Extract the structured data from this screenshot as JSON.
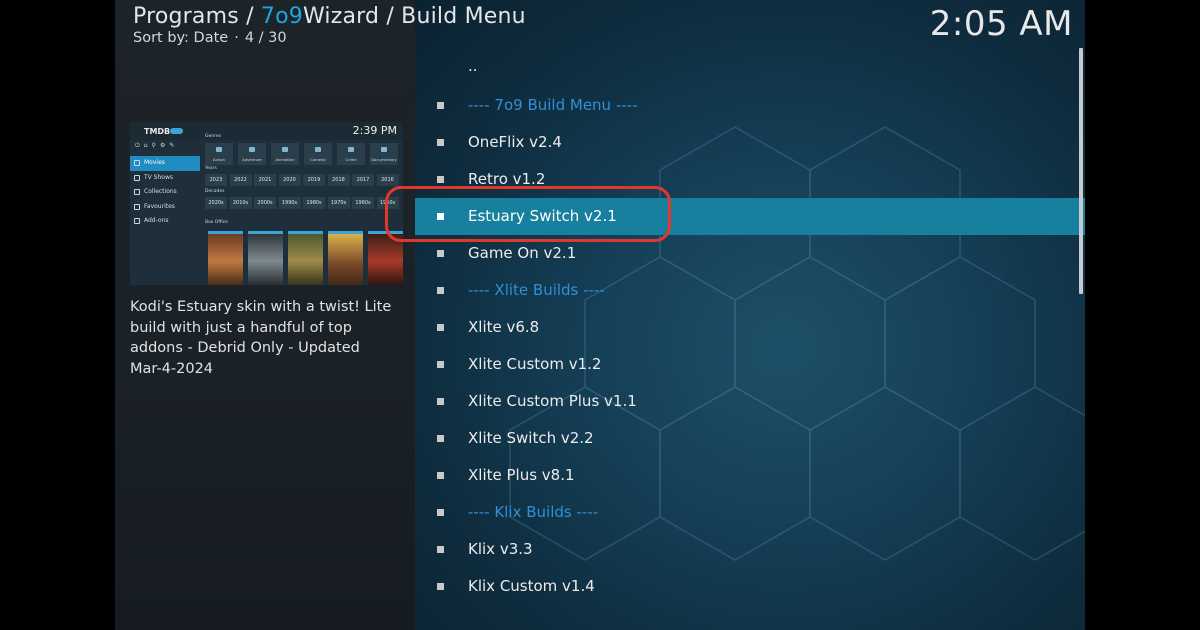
{
  "header": {
    "breadcrumb_prefix": "Programs / ",
    "breadcrumb_accent": "7o9",
    "breadcrumb_suffix": "Wizard / Build Menu",
    "sort_label": "Sort by: Date",
    "position": "4 / 30",
    "clock": "2:05 AM"
  },
  "preview": {
    "screenshot": {
      "logo": "TMDB",
      "time": "2:39 PM",
      "genres_label": "Genres",
      "genres": [
        "Action",
        "Adventure",
        "Animation",
        "Comedy",
        "Crime",
        "Documentary"
      ],
      "years_label": "Years",
      "years": [
        "2023",
        "2022",
        "2021",
        "2020",
        "2019",
        "2018",
        "2017",
        "2016"
      ],
      "decades_label": "Decades",
      "decades": [
        "2020s",
        "2010s",
        "2000s",
        "1990s",
        "1980s",
        "1970s",
        "1960s",
        "1950s"
      ],
      "box_office_label": "Box Office",
      "nav": [
        "Movies",
        "TV Shows",
        "Collections",
        "Favourites",
        "Add-ons"
      ],
      "active_nav": "Movies"
    },
    "description": "Kodi's Estuary skin with a twist! Lite\nbuild with just a handful of top\naddons - Debrid Only - Updated\nMar-4-2024"
  },
  "list": {
    "parent": "..",
    "items": [
      {
        "label": "---- 7o9 Build Menu ----",
        "kind": "section"
      },
      {
        "label": "OneFlix v2.4",
        "kind": "item"
      },
      {
        "label": "Retro v1.2",
        "kind": "item"
      },
      {
        "label": "Estuary Switch v2.1",
        "kind": "item",
        "selected": true
      },
      {
        "label": "Game On v2.1",
        "kind": "item"
      },
      {
        "label": "---- Xlite Builds ----",
        "kind": "section"
      },
      {
        "label": "Xlite v6.8",
        "kind": "item"
      },
      {
        "label": "Xlite Custom v1.2",
        "kind": "item"
      },
      {
        "label": "Xlite Custom Plus v1.1",
        "kind": "item"
      },
      {
        "label": "Xlite Switch v2.2",
        "kind": "item"
      },
      {
        "label": "Xlite Plus v8.1",
        "kind": "item"
      },
      {
        "label": "---- Klix Builds ----",
        "kind": "section"
      },
      {
        "label": "Klix v3.3",
        "kind": "item"
      },
      {
        "label": "Klix Custom v1.4",
        "kind": "item"
      }
    ]
  },
  "colors": {
    "accent": "#1fa6de",
    "section_text": "#2f8fd8",
    "selection": "#17809f",
    "annotation_ring": "#e2372c"
  }
}
